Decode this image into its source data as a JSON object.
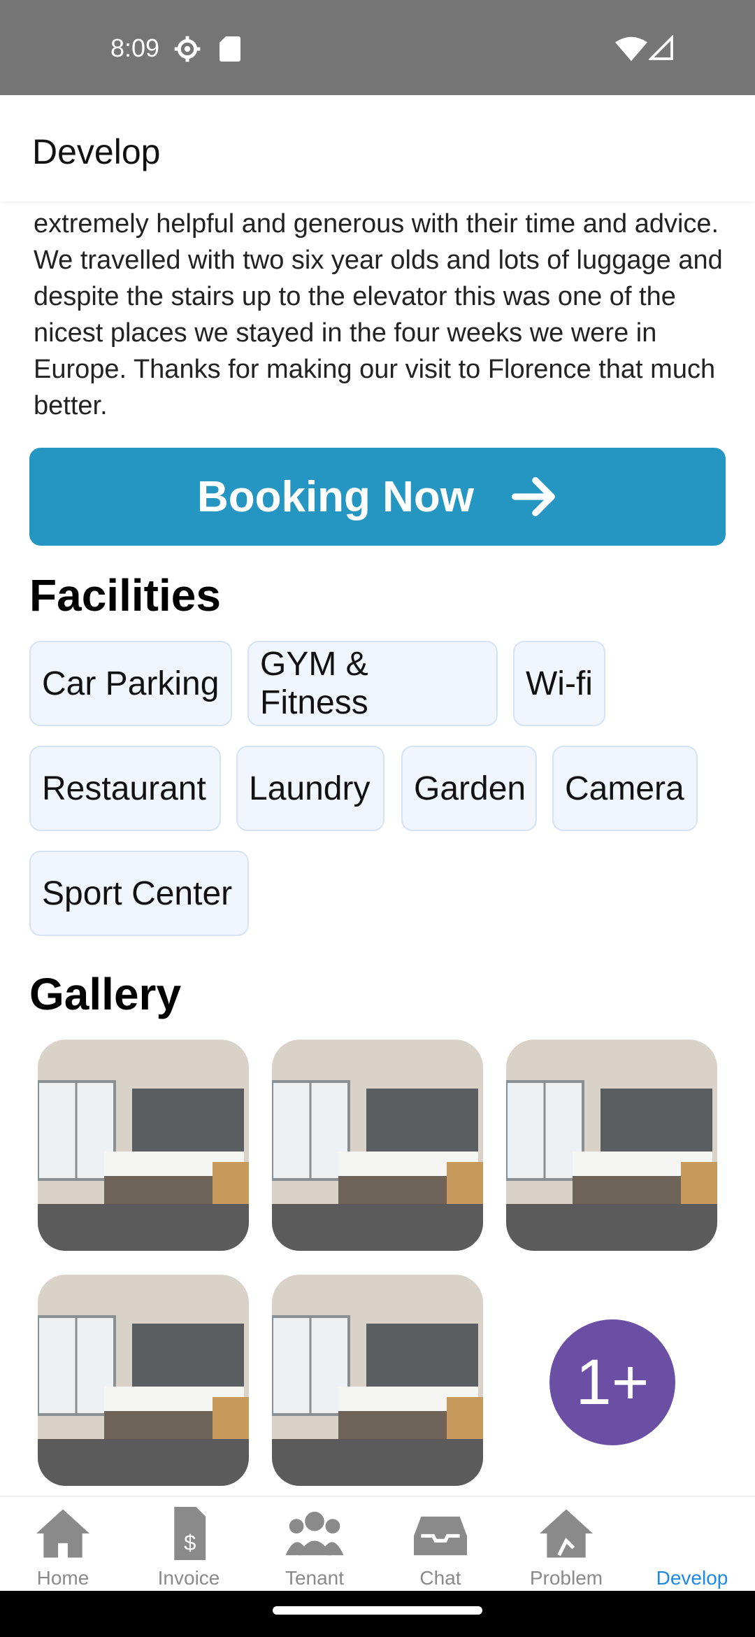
{
  "status_bar": {
    "time": "8:09",
    "icons": [
      "gear-icon",
      "sd-card-icon",
      "wifi-icon",
      "cell-signal-icon"
    ]
  },
  "app_bar": {
    "title": "Develop"
  },
  "review": {
    "text": "Everyone we met here were wonderful people and extremely helpful and generous with their time and advice. We travelled with two six year olds and lots of luggage and despite the stairs up to the elevator this was one of the nicest places we stayed in the four weeks we were in Europe. Thanks for making our visit to Florence that much better."
  },
  "booking": {
    "label": "Booking Now",
    "icon": "arrow-right-icon"
  },
  "facilities": {
    "title": "Facilities",
    "items": [
      "Car Parking",
      "GYM & Fitness",
      "Wi-fi",
      "Restaurant",
      "Laundry",
      "Garden",
      "Camera",
      "Sport Center"
    ]
  },
  "gallery": {
    "title": "Gallery",
    "more_label": "1+"
  },
  "nav": {
    "items": [
      {
        "label": "Home",
        "icon": "home-icon"
      },
      {
        "label": "Invoice",
        "icon": "invoice-icon"
      },
      {
        "label": "Tenant",
        "icon": "users-icon"
      },
      {
        "label": "Chat",
        "icon": "inbox-icon"
      },
      {
        "label": "Problem",
        "icon": "home-repair-icon"
      },
      {
        "label": "Develop",
        "icon": "develop-icon"
      }
    ],
    "active": "Develop"
  },
  "colors": {
    "primary": "#2496c1",
    "accent_circle": "#6a4fa4",
    "nav_active": "#1e88e5",
    "chip_bg": "#f1f5fd"
  }
}
